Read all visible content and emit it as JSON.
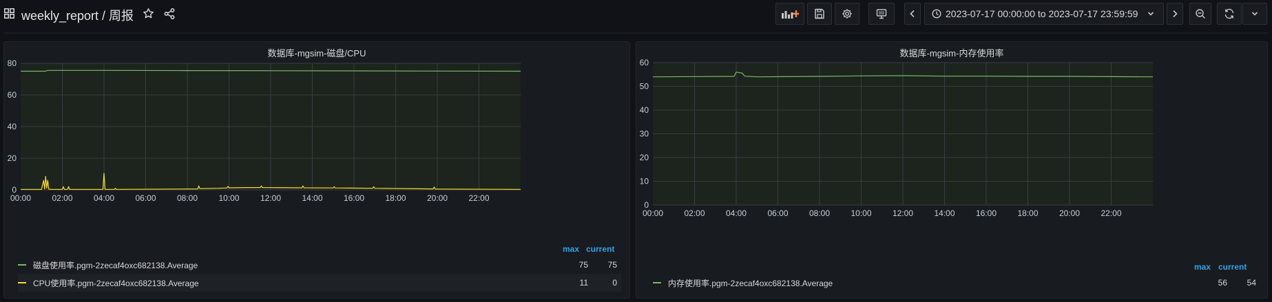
{
  "dashboard": {
    "title": "weekly_report / 周报"
  },
  "toolbar": {
    "time_range": "2023-07-17 00:00:00 to 2023-07-17 23:59:59",
    "icons": [
      "add-panel-icon",
      "save-icon",
      "settings-icon",
      "tv-mode-icon",
      "time-back-icon",
      "clock-icon",
      "time-forward-icon",
      "zoom-out-icon",
      "refresh-icon",
      "chevron-down-icon"
    ]
  },
  "colors": {
    "green": "#73bf69",
    "yellow": "#fade2a",
    "accent": "#33a2e5"
  },
  "panels": [
    {
      "title": "数据库-mgsim-磁盘/CPU",
      "legend_headers": {
        "max": "max",
        "current": "current"
      },
      "legend": [
        {
          "name": "磁盘使用率.pgm-2zecaf4oxc682138.Average",
          "max": "75",
          "current": "75"
        },
        {
          "name": "CPU使用率.pgm-2zecaf4oxc682138.Average",
          "max": "11",
          "current": "0"
        }
      ]
    },
    {
      "title": "数据库-mgsim-内存使用率",
      "legend_headers": {
        "max": "max",
        "current": "current"
      },
      "legend": [
        {
          "name": "内存使用率.pgm-2zecaf4oxc682138.Average",
          "max": "56",
          "current": "54"
        }
      ]
    }
  ],
  "chart_data": [
    {
      "type": "line",
      "title": "数据库-mgsim-磁盘/CPU",
      "x_ticks": [
        "00:00",
        "02:00",
        "04:00",
        "06:00",
        "08:00",
        "10:00",
        "12:00",
        "14:00",
        "16:00",
        "18:00",
        "20:00",
        "22:00"
      ],
      "y_ticks": [
        0,
        20,
        40,
        60,
        80
      ],
      "ylim": [
        0,
        80
      ],
      "xlim_hours": [
        0,
        24
      ],
      "grid": true,
      "series": [
        {
          "name": "磁盘使用率.pgm-2zecaf4oxc682138.Average",
          "color": "#73bf69",
          "points": [
            [
              0,
              75
            ],
            [
              1.2,
              75
            ],
            [
              1.3,
              75.5
            ],
            [
              4,
              75.5
            ],
            [
              8,
              75.4
            ],
            [
              12,
              75.3
            ],
            [
              16,
              75.2
            ],
            [
              20,
              75.1
            ],
            [
              24,
              75
            ]
          ]
        },
        {
          "name": "CPU使用率.pgm-2zecaf4oxc682138.Average",
          "color": "#fade2a",
          "points": [
            [
              0,
              0.3
            ],
            [
              1.0,
              0.3
            ],
            [
              1.1,
              6
            ],
            [
              1.15,
              0.5
            ],
            [
              1.2,
              8.5
            ],
            [
              1.25,
              1
            ],
            [
              1.3,
              6
            ],
            [
              1.35,
              0.4
            ],
            [
              1.5,
              0.3
            ],
            [
              2.0,
              0.3
            ],
            [
              2.05,
              2
            ],
            [
              2.1,
              0.3
            ],
            [
              2.25,
              0.3
            ],
            [
              2.3,
              2
            ],
            [
              2.35,
              0.3
            ],
            [
              3.95,
              0.3
            ],
            [
              4.0,
              10.5
            ],
            [
              4.05,
              0.3
            ],
            [
              4.5,
              0.3
            ],
            [
              4.55,
              1
            ],
            [
              4.6,
              0.3
            ],
            [
              7.5,
              0.5
            ],
            [
              8.5,
              0.6
            ],
            [
              8.55,
              2.5
            ],
            [
              8.6,
              0.8
            ],
            [
              9.5,
              1
            ],
            [
              9.9,
              1.2
            ],
            [
              9.95,
              2.2
            ],
            [
              10,
              1.3
            ],
            [
              11,
              1.5
            ],
            [
              11.5,
              1.5
            ],
            [
              11.55,
              2.5
            ],
            [
              11.6,
              1.5
            ],
            [
              13.5,
              1.3
            ],
            [
              13.55,
              2.5
            ],
            [
              13.6,
              1.3
            ],
            [
              15,
              1.2
            ],
            [
              15.05,
              2
            ],
            [
              15.1,
              1.2
            ],
            [
              16.9,
              1
            ],
            [
              16.95,
              2
            ],
            [
              17,
              1
            ],
            [
              19.8,
              0.6
            ],
            [
              19.85,
              1.8
            ],
            [
              19.9,
              0.5
            ],
            [
              24,
              0.3
            ]
          ]
        }
      ]
    },
    {
      "type": "line",
      "title": "数据库-mgsim-内存使用率",
      "x_ticks": [
        "00:00",
        "02:00",
        "04:00",
        "06:00",
        "08:00",
        "10:00",
        "12:00",
        "14:00",
        "16:00",
        "18:00",
        "20:00",
        "22:00"
      ],
      "y_ticks": [
        0,
        10,
        20,
        30,
        40,
        50,
        60
      ],
      "ylim": [
        0,
        60
      ],
      "xlim_hours": [
        0,
        24
      ],
      "grid": true,
      "series": [
        {
          "name": "内存使用率.pgm-2zecaf4oxc682138.Average",
          "color": "#73bf69",
          "points": [
            [
              0,
              54
            ],
            [
              3.9,
              54.2
            ],
            [
              4.0,
              56
            ],
            [
              4.3,
              55.5
            ],
            [
              4.4,
              54.3
            ],
            [
              5,
              54
            ],
            [
              8,
              54.2
            ],
            [
              9,
              54.3
            ],
            [
              10,
              54.4
            ],
            [
              12,
              54.5
            ],
            [
              14,
              54.3
            ],
            [
              16,
              54.3
            ],
            [
              18,
              54.2
            ],
            [
              20,
              54.2
            ],
            [
              22,
              54.1
            ],
            [
              24,
              54
            ]
          ]
        }
      ]
    }
  ]
}
